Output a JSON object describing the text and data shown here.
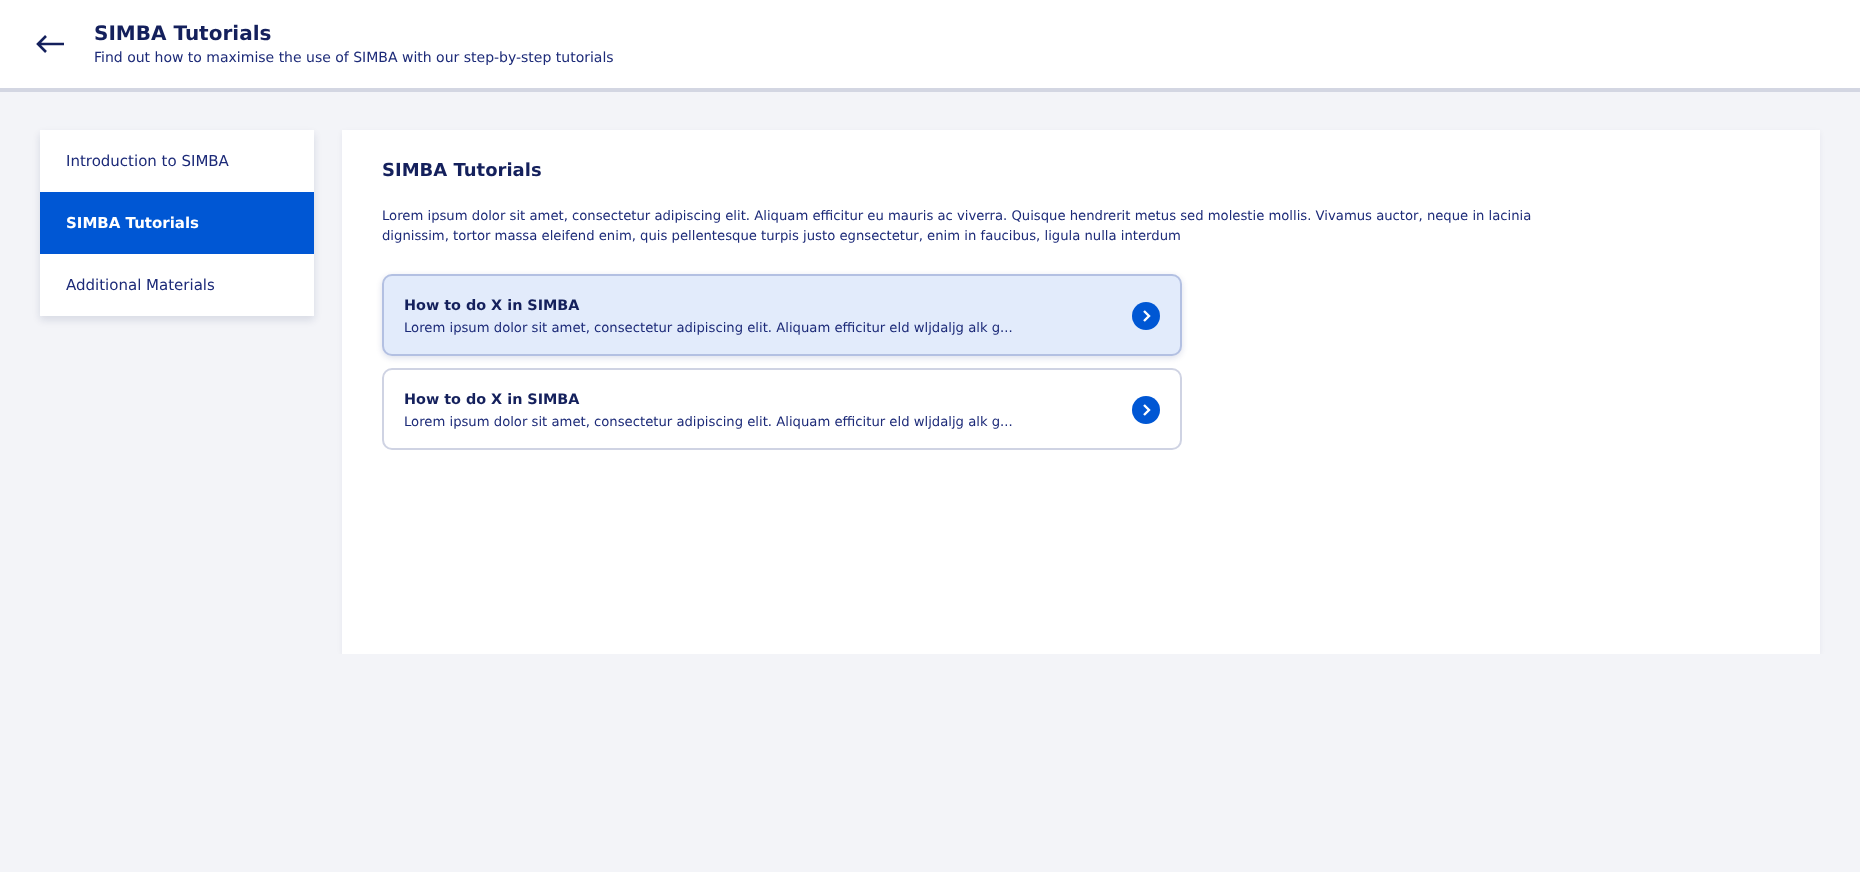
{
  "header": {
    "title": "SIMBA Tutorials",
    "subtitle": "Find out how to maximise the use of SIMBA with our step-by-step tutorials"
  },
  "sidebar": {
    "items": [
      {
        "label": "Introduction to SIMBA",
        "selected": false
      },
      {
        "label": "SIMBA Tutorials",
        "selected": true
      },
      {
        "label": "Additional Materials",
        "selected": false
      }
    ]
  },
  "main": {
    "title": "SIMBA Tutorials",
    "description": "Lorem ipsum dolor sit amet, consectetur adipiscing elit. Aliquam efficitur eu mauris ac viverra. Quisque hendrerit metus sed molestie mollis. Vivamus auctor, neque in lacinia dignissim, tortor massa eleifend enim, quis pellentesque turpis justo egnsectetur, enim in faucibus, ligula nulla interdum",
    "tutorials": [
      {
        "title": "How to do X in SIMBA",
        "summary": "Lorem ipsum dolor sit amet, consectetur adipiscing elit. Aliquam efficitur eld wljdaljg alk g...",
        "selected": true
      },
      {
        "title": "How to do X in SIMBA",
        "summary": "Lorem ipsum dolor sit amet, consectetur adipiscing elit. Aliquam efficitur eld wljdaljg alk g...",
        "selected": false
      }
    ]
  }
}
